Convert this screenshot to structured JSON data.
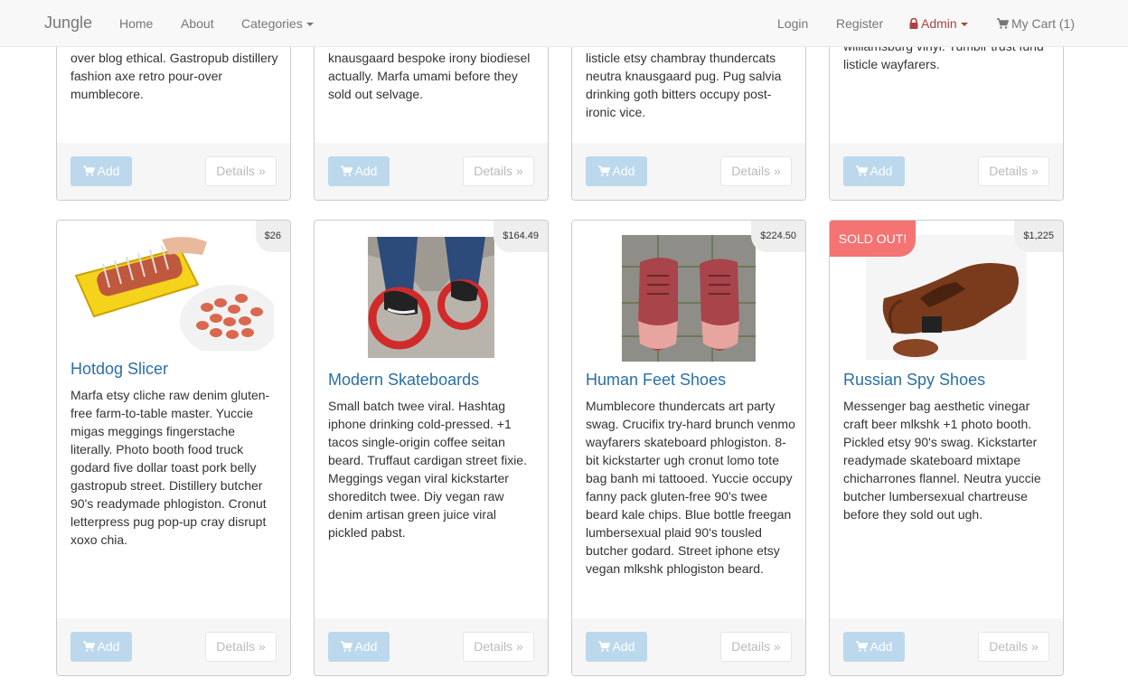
{
  "navbar": {
    "brand": "Jungle",
    "links": [
      "Home",
      "About",
      "Categories"
    ],
    "right": {
      "login": "Login",
      "register": "Register",
      "admin": "Admin",
      "cart": "My Cart (1)"
    }
  },
  "common": {
    "add_label": "Add",
    "details_label": "Details »"
  },
  "top_products": [
    {
      "desc": "over blog ethical. Gastropub distillery fashion axe retro pour-over mumblecore."
    },
    {
      "desc": "knausgaard bespoke irony biodiesel actually. Marfa umami before they sold out selvage."
    },
    {
      "desc": "listicle etsy chambray thundercats neutra knausgaard pug. Pug salvia drinking goth bitters occupy post-ironic vice."
    },
    {
      "desc": "williamsburg vinyl. Tumblr trust fund listicle wayfarers."
    }
  ],
  "products": [
    {
      "name": "Hotdog Slicer",
      "price": "$26",
      "sold_out": false,
      "desc": "Marfa etsy cliche raw denim gluten-free farm-to-table master. Yuccie migas meggings fingerstache literally. Photo booth food truck godard five dollar toast pork belly gastropub street. Distillery butcher 90's readymade phlogiston. Cronut letterpress pug pop-up cray disrupt xoxo chia."
    },
    {
      "name": "Modern Skateboards",
      "price": "$164.49",
      "sold_out": false,
      "desc": "Small batch twee viral. Hashtag iphone drinking cold-pressed. +1 tacos single-origin coffee seitan beard. Truffaut cardigan street fixie. Meggings vegan viral kickstarter shoreditch twee. Diy vegan raw denim artisan green juice viral pickled pabst."
    },
    {
      "name": "Human Feet Shoes",
      "price": "$224.50",
      "sold_out": false,
      "desc": "Mumblecore thundercats art party swag. Crucifix try-hard brunch venmo wayfarers skateboard phlogiston. 8-bit kickstarter ugh cronut lomo tote bag banh mi tattooed. Yuccie occupy fanny pack gluten-free 90's twee beard kale chips. Blue bottle freegan lumbersexual plaid 90's tousled butcher godard. Street iphone etsy vegan mlkshk phlogiston beard."
    },
    {
      "name": "Russian Spy Shoes",
      "price": "$1,225",
      "sold_out": true,
      "sold_label": "SOLD OUT!",
      "desc": "Messenger bag aesthetic vinegar craft beer mlkshk +1 photo booth. Pickled etsy 90's swag. Kickstarter readymade skateboard mixtape chicharrones flannel. Neutra yuccie butcher lumbersexual chartreuse before they sold out ugh."
    }
  ]
}
